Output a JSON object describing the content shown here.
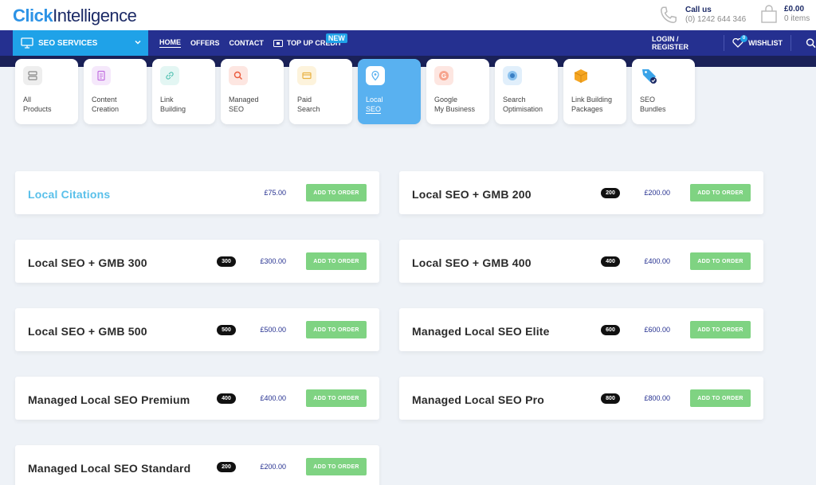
{
  "header": {
    "logo_click": "Click",
    "logo_intel": "Intelligence",
    "call_label": "Call us",
    "call_number": "(0) 1242 644 346",
    "cart_total": "£0.00",
    "cart_items": "0 items"
  },
  "nav": {
    "services_label": "SEO SERVICES",
    "home": "HOME",
    "offers": "OFFERS",
    "contact": "CONTACT",
    "topup": "TOP UP CREDIT",
    "new_badge": "NEW",
    "login": "LOGIN / REGISTER",
    "wishlist": "WISHLIST",
    "wishlist_count": "0"
  },
  "categories": [
    {
      "line1": "All",
      "line2": "Products",
      "icon": "stack-icon"
    },
    {
      "line1": "Content",
      "line2": "Creation",
      "icon": "document-icon"
    },
    {
      "line1": "Link",
      "line2": "Building",
      "icon": "link-icon"
    },
    {
      "line1": "Managed",
      "line2": "SEO",
      "icon": "magnifier-icon"
    },
    {
      "line1": "Paid",
      "line2": "Search",
      "icon": "card-icon"
    },
    {
      "line1": "Local",
      "line2": "SEO",
      "icon": "location-pin-icon"
    },
    {
      "line1": "Google",
      "line2": "My Business",
      "icon": "google-icon"
    },
    {
      "line1": "Search",
      "line2": "Optimisation",
      "icon": "globe-icon"
    },
    {
      "line1": "Link Building",
      "line2": "Packages",
      "icon": "box-icon"
    },
    {
      "line1": "SEO",
      "line2": "Bundles",
      "icon": "tag-icon"
    }
  ],
  "products": [
    {
      "name": "Local Citations",
      "qty": "",
      "price": "£75.00",
      "button": "ADD TO ORDER"
    },
    {
      "name": "Local SEO + GMB 200",
      "qty": "200",
      "price": "£200.00",
      "button": "ADD TO ORDER"
    },
    {
      "name": "Local SEO + GMB 300",
      "qty": "300",
      "price": "£300.00",
      "button": "ADD TO ORDER"
    },
    {
      "name": "Local SEO + GMB 400",
      "qty": "400",
      "price": "£400.00",
      "button": "ADD TO ORDER"
    },
    {
      "name": "Local SEO + GMB 500",
      "qty": "500",
      "price": "£500.00",
      "button": "ADD TO ORDER"
    },
    {
      "name": "Managed Local SEO Elite",
      "qty": "600",
      "price": "£600.00",
      "button": "ADD TO ORDER"
    },
    {
      "name": "Managed Local SEO Premium",
      "qty": "400",
      "price": "£400.00",
      "button": "ADD TO ORDER"
    },
    {
      "name": "Managed Local SEO Pro",
      "qty": "800",
      "price": "£800.00",
      "button": "ADD TO ORDER"
    },
    {
      "name": "Managed Local SEO Standard",
      "qty": "200",
      "price": "£200.00",
      "button": "ADD TO ORDER"
    }
  ],
  "colors": {
    "nav_bg": "#253090",
    "accent_blue": "#1fa2e8",
    "active_tile": "#59b1f0",
    "add_button": "#7fd382"
  }
}
